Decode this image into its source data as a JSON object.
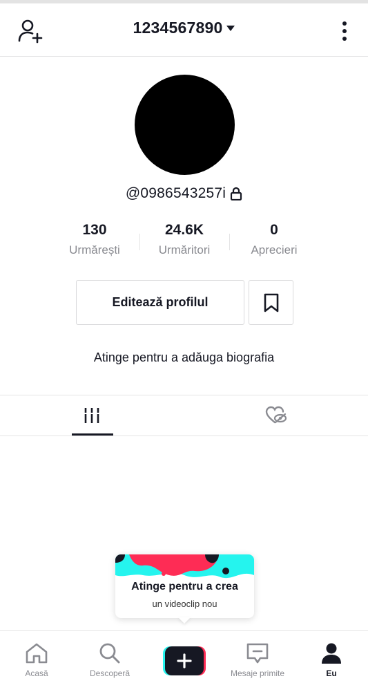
{
  "header": {
    "username": "1234567890"
  },
  "profile": {
    "handle": "@0986543257i",
    "stats": [
      {
        "value": "130",
        "label": "Urmărești"
      },
      {
        "value": "24.6K",
        "label": "Urmăritori"
      },
      {
        "value": "0",
        "label": "Aprecieri"
      }
    ],
    "edit_button": "Editează profilul",
    "bio_prompt": "Atinge pentru a adăuga biografia"
  },
  "tabs": {
    "videos_icon": "grid-icon",
    "liked_icon": "hidden-liked-icon"
  },
  "create_card": {
    "title": "Atinge pentru a crea",
    "subtitle": "un videoclip nou"
  },
  "bottom_nav": {
    "items": [
      {
        "label": "Acasă",
        "icon": "home-icon"
      },
      {
        "label": "Descoperă",
        "icon": "search-icon"
      },
      {
        "label": "",
        "icon": "plus-icon"
      },
      {
        "label": "Mesaje primite",
        "icon": "inbox-icon"
      },
      {
        "label": "Eu",
        "icon": "profile-icon"
      }
    ]
  },
  "colors": {
    "text": "#161823",
    "muted": "#8a8b91",
    "accent_cyan": "#25f4ee",
    "accent_red": "#fe2c55",
    "border": "#e3e3e4"
  }
}
